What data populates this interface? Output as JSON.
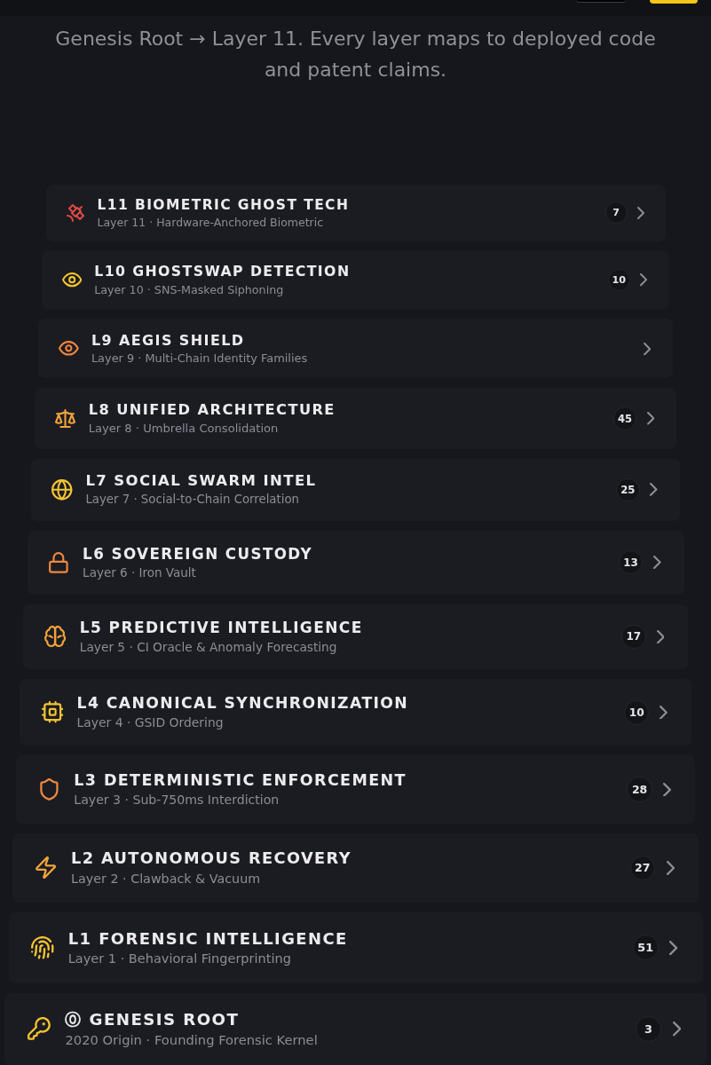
{
  "header": {
    "buttons": [
      {
        "kind": "secondary"
      },
      {
        "kind": "primary"
      }
    ]
  },
  "intro": "Genesis Root → Layer 11. Every layer maps to deployed code and patent claims.",
  "layers": [
    {
      "kind": "satellite",
      "color": "#e04a45",
      "title": "L11 BIOMETRIC GHOST TECH",
      "subtitle": "Layer 11 · Hardware-Anchored Biometric",
      "count": "7"
    },
    {
      "kind": "eye",
      "color": "#f4c430",
      "title": "L10 GHOSTSWAP DETECTION",
      "subtitle": "Layer 10 · SNS-Masked Siphoning",
      "count": "10"
    },
    {
      "kind": "eye",
      "color": "#f0883e",
      "title": "L9 AEGIS SHIELD",
      "subtitle": "Layer 9 · Multi-Chain Identity Families"
    },
    {
      "kind": "scale",
      "color": "#f2a33a",
      "title": "L8 UNIFIED ARCHITECTURE",
      "subtitle": "Layer 8 · Umbrella Consolidation",
      "count": "45"
    },
    {
      "kind": "globe",
      "color": "#f4c430",
      "title": "L7 SOCIAL SWARM INTEL",
      "subtitle": "Layer 7 · Social-to-Chain Correlation",
      "count": "25"
    },
    {
      "kind": "lock",
      "color": "#f0883e",
      "title": "L6 SOVEREIGN CUSTODY",
      "subtitle": "Layer 6 · Iron Vault",
      "count": "13"
    },
    {
      "kind": "brain",
      "color": "#f2a33a",
      "title": "L5 PREDICTIVE INTELLIGENCE",
      "subtitle": "Layer 5 · CI Oracle & Anomaly Forecasting",
      "count": "17"
    },
    {
      "kind": "chip",
      "color": "#f4c430",
      "title": "L4 CANONICAL SYNCHRONIZATION",
      "subtitle": "Layer 4 · GSID Ordering",
      "count": "10"
    },
    {
      "kind": "shield",
      "color": "#f0883e",
      "title": "L3 DETERMINISTIC ENFORCEMENT",
      "subtitle": "Layer 3 · Sub-750ms Interdiction",
      "count": "28"
    },
    {
      "kind": "bolt",
      "color": "#f2a33a",
      "title": "L2 AUTONOMOUS RECOVERY",
      "subtitle": "Layer 2 · Clawback & Vacuum",
      "count": "27"
    },
    {
      "kind": "fingerprint",
      "color": "#f4c430",
      "title": "L1 FORENSIC INTELLIGENCE",
      "subtitle": "Layer 1 · Behavioral Fingerprinting",
      "count": "51"
    },
    {
      "kind": "key",
      "color": "#f4c430",
      "title": "⓪ GENESIS ROOT",
      "subtitle": "2020 Origin · Founding Forensic Kernel",
      "count": "3"
    }
  ]
}
